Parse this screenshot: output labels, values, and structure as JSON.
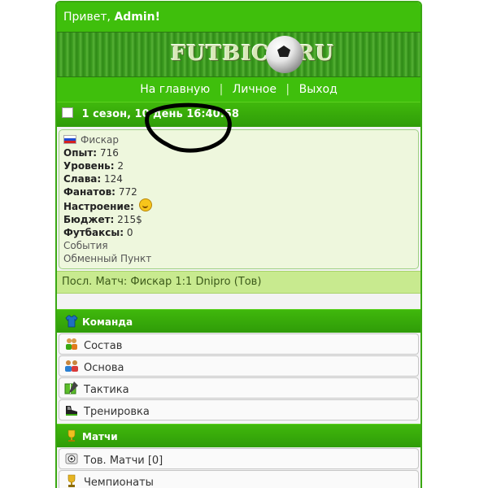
{
  "header": {
    "greeting_prefix": "Привет,",
    "user": "Admin!"
  },
  "banner": {
    "logo_text": "FUTBICK.RU"
  },
  "nav": {
    "items": [
      "На главную",
      "Личное",
      "Выход"
    ],
    "separator": "|"
  },
  "status": {
    "season_day": "1 сезон, 10 день",
    "time": "16:40:58"
  },
  "team": {
    "name": "Фискар",
    "stats": [
      {
        "label": "Опыт:",
        "value": "716"
      },
      {
        "label": "Уровень:",
        "value": "2"
      },
      {
        "label": "Слава:",
        "value": "124"
      },
      {
        "label": "Фанатов:",
        "value": "772"
      },
      {
        "label": "Настроение:",
        "value": ""
      },
      {
        "label": "Бюджет:",
        "value": "215$"
      },
      {
        "label": "Футбаксы:",
        "value": "0"
      }
    ],
    "links": [
      "События",
      "Обменный Пункт"
    ]
  },
  "last_match": "Посл. Матч: Фискар 1:1 Dnipro (Тов)",
  "sections": [
    {
      "title": "Команда",
      "icon": "jersey-icon",
      "items": [
        {
          "label": "Состав",
          "icon": "players-icon"
        },
        {
          "label": "Основа",
          "icon": "group-icon"
        },
        {
          "label": "Тактика",
          "icon": "tactics-icon"
        },
        {
          "label": "Тренировка",
          "icon": "boot-icon"
        }
      ]
    },
    {
      "title": "Матчи",
      "icon": "trophy-icon",
      "items": [
        {
          "label": "Тов. Матчи [0]",
          "icon": "ball-icon"
        },
        {
          "label": "Чемпионаты",
          "icon": "cup-icon"
        }
      ]
    }
  ],
  "colors": {
    "primary_green": "#3fbf0c",
    "panel_bg": "#eef7dd",
    "last_match_bg": "#c8ea8f"
  }
}
